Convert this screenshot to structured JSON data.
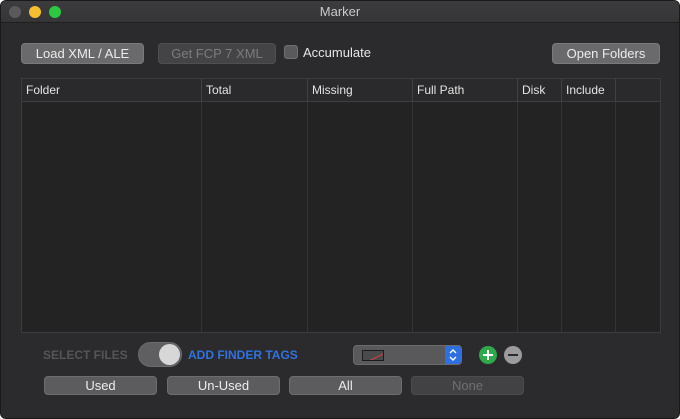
{
  "window": {
    "title": "Marker"
  },
  "toolbar": {
    "load_xml_label": "Load XML / ALE",
    "get_fcp_label": "Get FCP 7 XML",
    "accumulate_label": "Accumulate",
    "accumulate_checked": false,
    "open_folders_label": "Open Folders"
  },
  "table": {
    "columns": [
      "Folder",
      "Total",
      "Missing",
      "Full Path",
      "Disk",
      "Include"
    ],
    "rows": []
  },
  "tags": {
    "select_files_label": "SELECT FILES",
    "add_finder_tags_label": "ADD FINDER TAGS",
    "toggle_state": "on",
    "color_swatch": "none"
  },
  "filters": {
    "used_label": "Used",
    "unused_label": "Un-Used",
    "all_label": "All",
    "none_label": "None"
  },
  "colors": {
    "accent_blue": "#2f73e0",
    "add_green": "#2fa94a",
    "window_bg": "#2b2b2d"
  }
}
